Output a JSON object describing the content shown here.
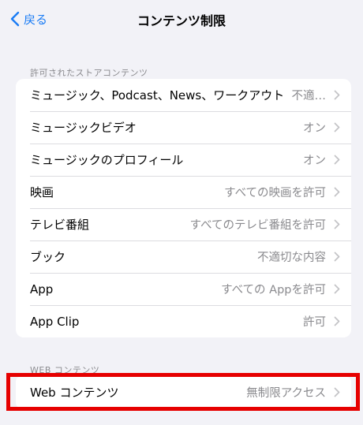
{
  "navbar": {
    "back_label": "戻る",
    "title": "コンテンツ制限"
  },
  "store_section": {
    "header": "許可されたストアコンテンツ",
    "rows": [
      {
        "label": "ミュージック、Podcast、News、ワークアウト",
        "value": "不適…"
      },
      {
        "label": "ミュージックビデオ",
        "value": "オン"
      },
      {
        "label": "ミュージックのプロフィール",
        "value": "オン"
      },
      {
        "label": "映画",
        "value": "すべての映画を許可"
      },
      {
        "label": "テレビ番組",
        "value": "すべてのテレビ番組を許可"
      },
      {
        "label": "ブック",
        "value": "不適切な内容"
      },
      {
        "label": "App",
        "value": "すべての Appを許可"
      },
      {
        "label": "App Clip",
        "value": "許可"
      }
    ]
  },
  "web_section": {
    "header": "WEB コンテンツ",
    "rows": [
      {
        "label": "Web コンテンツ",
        "value": "無制限アクセス"
      }
    ]
  },
  "colors": {
    "accent": "#1a7cf5",
    "highlight": "#e60000",
    "background": "#f2f2f7"
  }
}
